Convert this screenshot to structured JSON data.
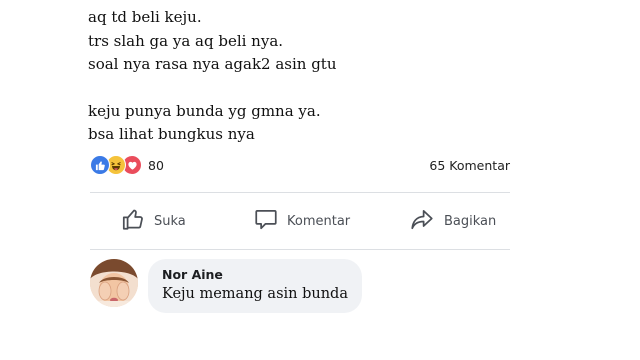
{
  "post": {
    "lines": [
      "aq td beli keju.",
      "trs slah ga ya aq beli nya.",
      "soal nya rasa nya agak2 asin gtu",
      "keju punya bunda yg gmna ya.",
      "bsa lihat bungkus nya"
    ]
  },
  "reactions": {
    "icons": [
      "like-icon",
      "haha-icon",
      "love-icon"
    ],
    "count": "80",
    "comments": "65 Komentar"
  },
  "actions": {
    "like_label": "Suka",
    "comment_label": "Komentar",
    "share_label": "Bagikan"
  },
  "comment": {
    "author": "Nor Aine",
    "text": "Keju memang asin bunda"
  },
  "colors": {
    "like_blue": "#3b7ae6",
    "haha_yellow": "#f5c33b",
    "love_red": "#ea4d5c",
    "action_gray": "#4b4f56",
    "bubble_bg": "#f0f2f5"
  }
}
